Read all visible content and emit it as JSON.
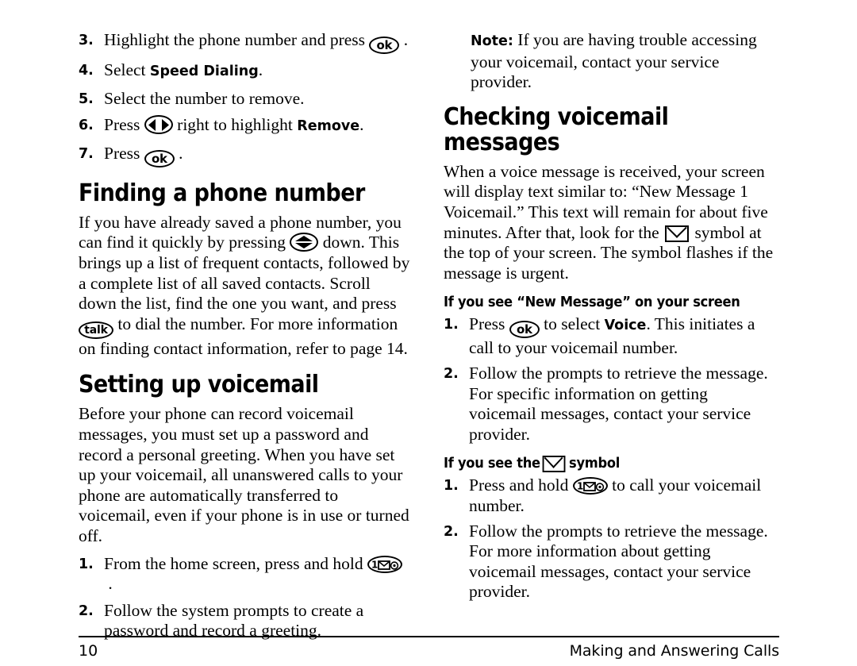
{
  "document": {
    "page_number": "10",
    "footer_title": "Making and Answering Calls"
  },
  "icons": {
    "ok_key": "ok",
    "talk_key": "talk",
    "one_key": "1",
    "nav_lr": "left-right-navigation-key",
    "nav_ud": "up-down-navigation-key",
    "envelope": "envelope-symbol"
  },
  "left_column": {
    "continued_steps": [
      {
        "number": "3.",
        "parts": [
          {
            "type": "text",
            "value": "Highlight the phone number and press "
          },
          {
            "type": "icon",
            "value": "ok"
          },
          {
            "type": "text",
            "value": " ."
          }
        ],
        "plain": "Highlight the phone number and press ok ."
      },
      {
        "number": "4.",
        "plain": "Select Speed Dialing.",
        "bold_term": "Speed Dialing"
      },
      {
        "number": "5.",
        "plain": "Select the number to remove."
      },
      {
        "number": "6.",
        "plain": "Press  right to highlight Remove.",
        "bold_term": "Remove"
      },
      {
        "number": "7.",
        "plain": "Press ok ."
      }
    ],
    "step3": {
      "text_before": "Highlight the phone number and press",
      "text_after": "."
    },
    "step4": {
      "text_before": "Select",
      "bold": "Speed Dialing",
      "text_after": "."
    },
    "step5": {
      "text": "Select the number to remove."
    },
    "step6": {
      "text_before": "Press",
      "text_mid": "right to highlight",
      "bold": "Remove",
      "text_after": "."
    },
    "step7": {
      "text_before": "Press",
      "text_after": "."
    },
    "heading_finding": "Finding a phone number",
    "finding_body": {
      "part1": "If you have already saved a phone number, you can find it quickly by pressing",
      "part2": "down. This brings up a list of frequent contacts, followed by a complete list of all saved contacts. Scroll down the list, find the one you want, and press",
      "part3": "to dial the number. For more information on finding contact information, refer to page 14."
    },
    "heading_setting": "Setting up voicemail",
    "setting_body": "Before your phone can record voicemail messages, you must set up a password and record a personal greeting. When you have set up your voicemail, all unanswered calls to your phone are automatically transferred to voicemail, even if your phone is in use or turned off.",
    "setting_steps": [
      {
        "number": "1.",
        "text_before": "From the home screen, press and hold",
        "text_after": "."
      },
      {
        "number": "2.",
        "text": "Follow the system prompts to create a password and record a greeting."
      }
    ]
  },
  "right_column": {
    "note": {
      "label": "Note:",
      "text": " If you are having trouble accessing your voicemail, contact your service provider."
    },
    "heading_checking": "Checking voicemail messages",
    "checking_body": {
      "part1": "When a voice message is received, your screen will display text similar to: “New Message 1 Voicemail.” This text will remain for about five minutes. After that, look for the",
      "part2": "symbol at the top of your screen. The symbol flashes if the message is urgent."
    },
    "subhead_new_message": "If you see “New Message” on your screen",
    "new_message_steps": [
      {
        "number": "1.",
        "text_before": "Press",
        "text_mid": "to select",
        "bold": "Voice",
        "text_after": ". This initiates a call to your voicemail number."
      },
      {
        "number": "2.",
        "text": "Follow the prompts to retrieve the message. For specific information on getting voicemail messages, contact your service provider."
      }
    ],
    "subhead_symbol": {
      "before": "If you see the",
      "after": "symbol"
    },
    "symbol_steps": [
      {
        "number": "1.",
        "text_before": "Press and hold",
        "text_after": "to call your voicemail number."
      },
      {
        "number": "2.",
        "text": "Follow the prompts to retrieve the message. For more information about getting voicemail messages, contact your service provider."
      }
    ]
  }
}
